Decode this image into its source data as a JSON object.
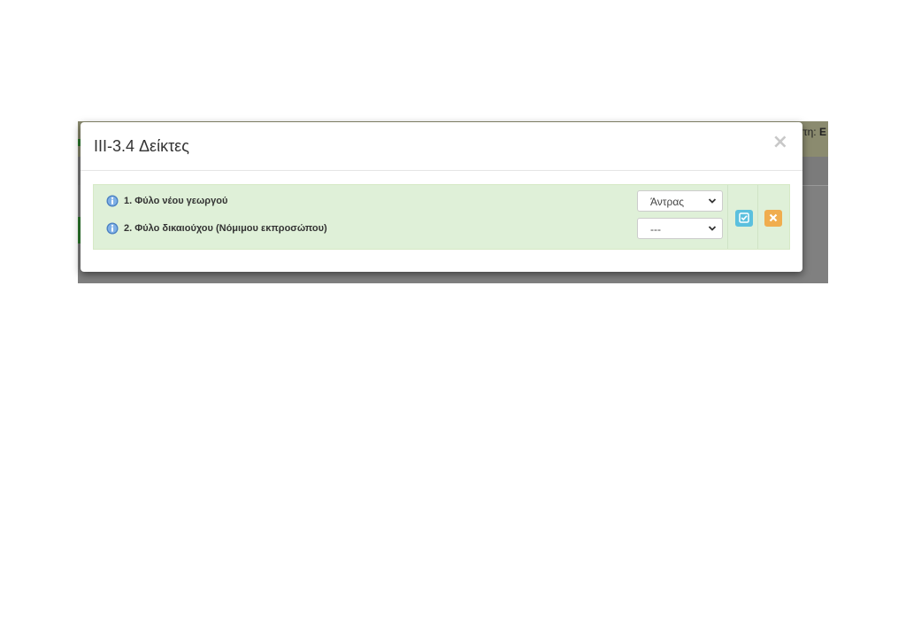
{
  "background": {
    "header_text_prefix": "στη:",
    "header_text_bold": "Ε"
  },
  "modal": {
    "title": "III-3.4 Δείκτες",
    "close_label": "×"
  },
  "indicators": [
    {
      "label": "1. Φύλο νέου γεωργού",
      "selected": "Άντρας"
    },
    {
      "label": "2. Φύλο δικαιούχου (Νόμιμου εκπροσώπου)",
      "selected": "---"
    }
  ],
  "icons": {
    "info": "info-icon",
    "chevron": "chevron-down-icon",
    "confirm": "check-square-icon",
    "cancel": "close-icon"
  },
  "colors": {
    "panel_bg": "#dff0d8",
    "confirm_button": "#5bc0de",
    "cancel_button": "#f0ad4e"
  }
}
